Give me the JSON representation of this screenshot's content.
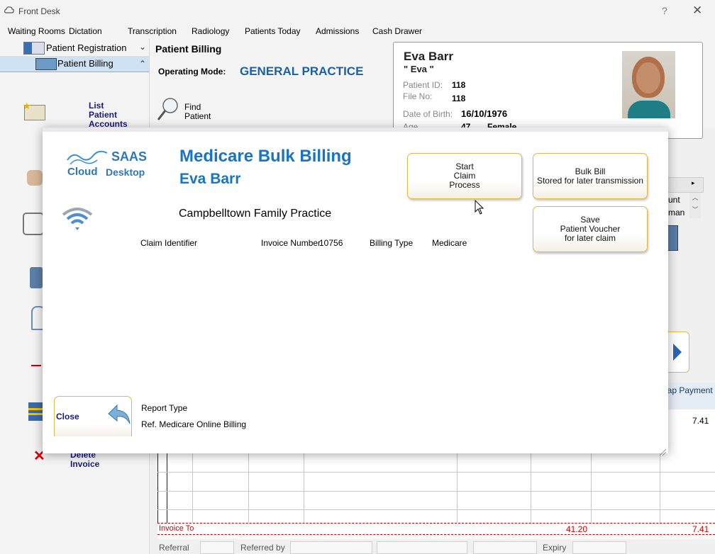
{
  "window": {
    "title": "Front Desk",
    "help": "?",
    "close": "✕"
  },
  "menu": [
    "Waiting Rooms",
    "Dictation",
    "Transcription",
    "Radiology",
    "Patients Today",
    "Admissions",
    "Cash Drawer"
  ],
  "sidebar": {
    "patient_registration": "Patient Registration",
    "patient_billing": "Patient Billing",
    "list_accounts": [
      "List",
      "Patient",
      "Accounts"
    ],
    "delete_invoice": [
      "Delete",
      "Invoice"
    ]
  },
  "header": {
    "section_title": "Patient Billing",
    "operating_mode_label": "Operating Mode:",
    "operating_mode_value": "GENERAL PRACTICE",
    "find_patient": [
      "Find",
      "Patient"
    ]
  },
  "patient": {
    "name": "Eva Barr",
    "nickname": "\" Eva \"",
    "patient_id_label": "Patient ID:",
    "patient_id": "118",
    "file_no_label": "File No:",
    "file_no": "118",
    "dob_label": "Date of Birth:",
    "dob": "16/10/1976",
    "age_label": "Age",
    "age": "47",
    "sex": "Female"
  },
  "table": {
    "header_frag_1": "unt",
    "header_frag_2": "man",
    "gap_payment_header": "Gap Payment",
    "gap_value": "7.41",
    "invoice_total_label": "Invoice To",
    "total_amount": "41.20",
    "total_gap": "7.41"
  },
  "footer": {
    "referral": "Referral",
    "referred_by": "Referred by",
    "expiry": "Expiry"
  },
  "modal": {
    "logo_top": "SAAS",
    "logo_cloud": "Cloud",
    "logo_desktop": "Desktop",
    "title": "Medicare Bulk Billing",
    "patient_name": "Eva Barr",
    "practice": "Campbelltown Family Practice",
    "claim_identifier_label": "Claim Identifier",
    "invoice_number_label": "Invoice Number",
    "invoice_number": "10756",
    "billing_type_label": "Billing Type",
    "billing_type": "Medicare",
    "start_claim": [
      "Start",
      "Claim",
      "Process"
    ],
    "bulk_bill": [
      "Bulk Bill",
      "Stored for later transmission"
    ],
    "save_voucher": [
      "Save",
      "Patient Voucher",
      "for later claim"
    ],
    "close": "Close",
    "report_type_label": "Report Type",
    "report_type_value": "Ref. Medicare Online Billing"
  },
  "colors": {
    "accent_blue": "#1874c4",
    "button_border": "#e2b84c",
    "total_red": "#cc0000",
    "nav_blue": "#1a1a7a"
  }
}
